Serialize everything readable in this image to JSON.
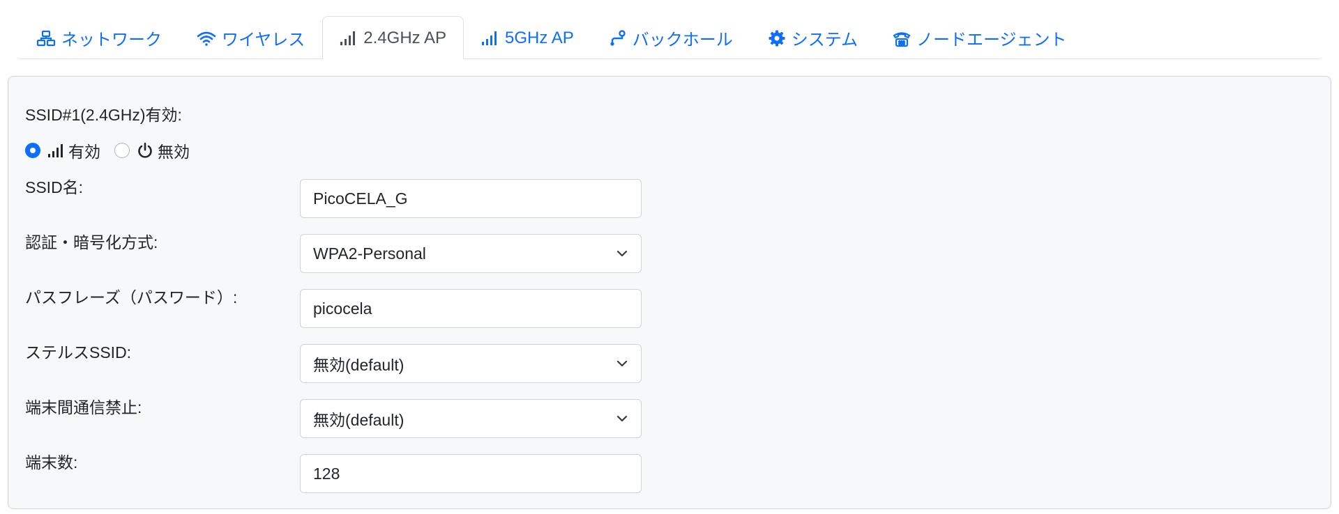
{
  "tabs": [
    {
      "label": "ネットワーク",
      "icon": "network-icon",
      "active": false
    },
    {
      "label": "ワイヤレス",
      "icon": "wifi-icon",
      "active": false
    },
    {
      "label": "2.4GHz AP",
      "icon": "signal-bars-icon",
      "active": true
    },
    {
      "label": "5GHz AP",
      "icon": "signal-bars-icon",
      "active": false
    },
    {
      "label": "バックホール",
      "icon": "route-icon",
      "active": false
    },
    {
      "label": "システム",
      "icon": "gear-icon",
      "active": false
    },
    {
      "label": "ノードエージェント",
      "icon": "telephone-icon",
      "active": false
    }
  ],
  "form": {
    "ssid_enable_label": "SSID#1(2.4GHz)有効:",
    "enable_option": "有効",
    "disable_option": "無効",
    "selected": "有効",
    "ssid_name_label": "SSID名:",
    "ssid_name_value": "PicoCELA_G",
    "auth_label": "認証・暗号化方式:",
    "auth_value": "WPA2-Personal",
    "passphrase_label": "パスフレーズ（パスワード）:",
    "passphrase_value": "picocela",
    "stealth_label": "ステルスSSID:",
    "stealth_value": "無効(default)",
    "isolation_label": "端末間通信禁止:",
    "isolation_value": "無効(default)",
    "clients_label": "端末数:",
    "clients_value": "128"
  },
  "colors": {
    "accent": "#0d6efd",
    "panel_bg": "#f7f8fa",
    "border": "#ced4da"
  }
}
